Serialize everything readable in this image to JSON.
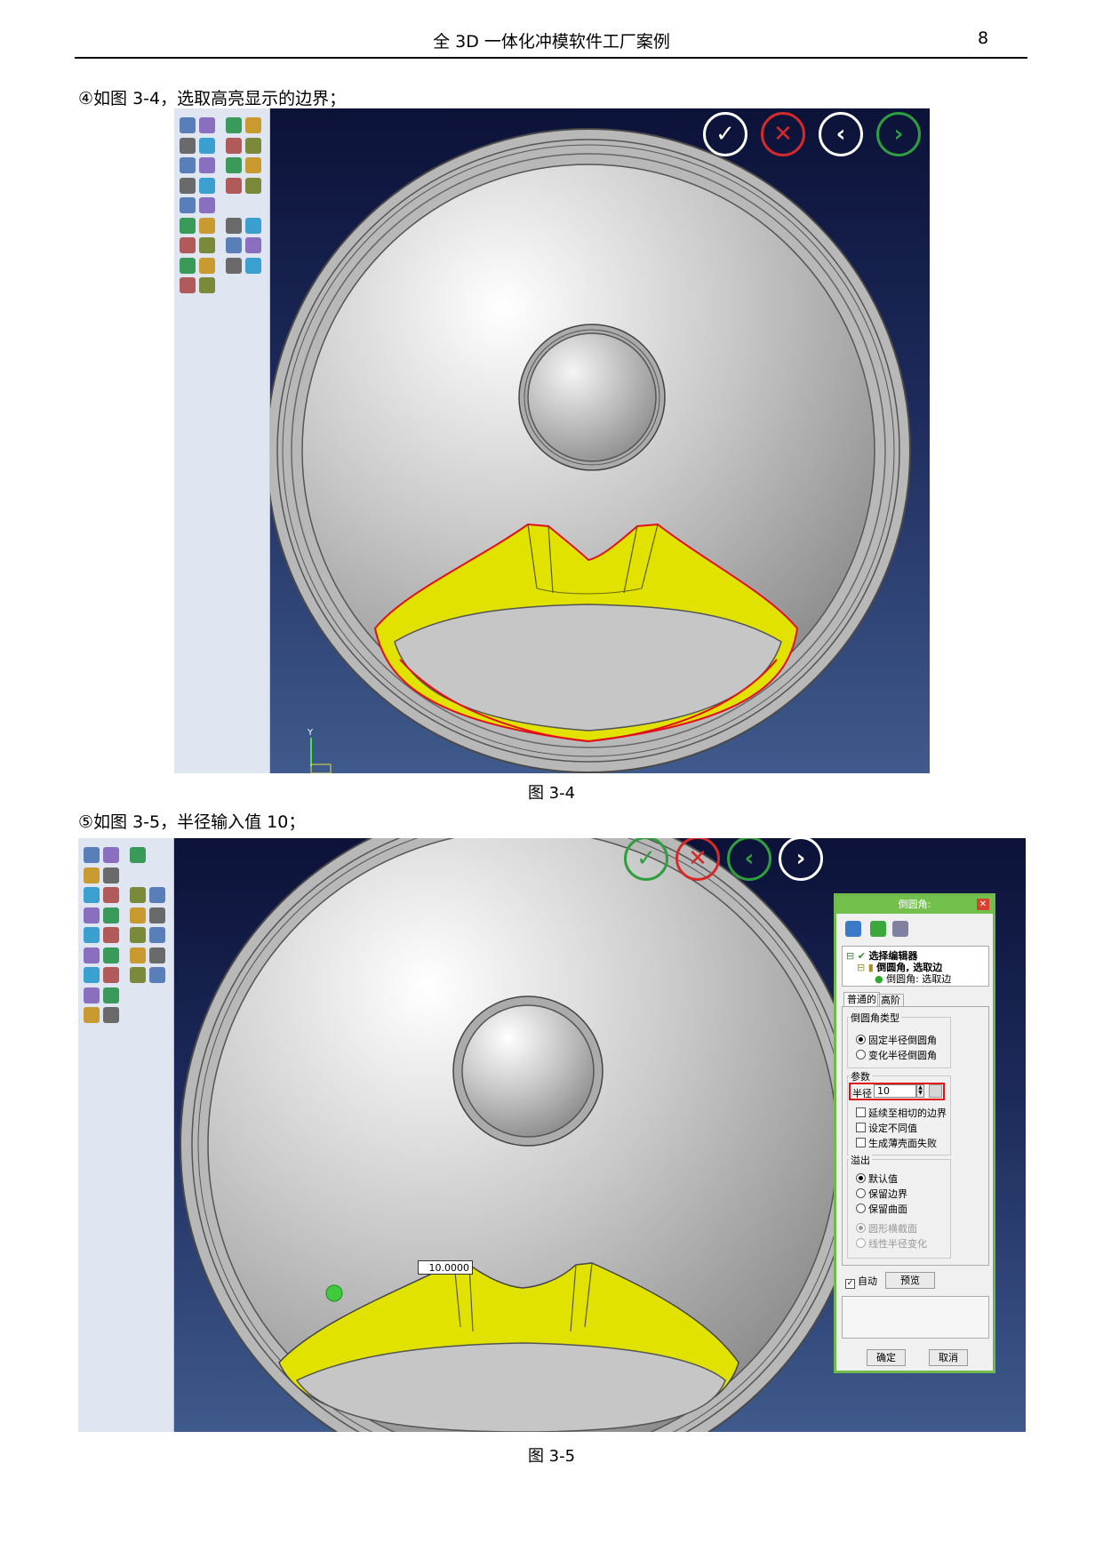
{
  "header": {
    "title": "全 3D 一体化冲模软件工厂案例",
    "page_number": "8"
  },
  "steps": [
    {
      "text": "④如图 3-4，选取高亮显示的边界；"
    },
    {
      "text": "⑤如图 3-5，半径输入值 10；"
    }
  ],
  "figures": [
    {
      "caption": "图 3-4"
    },
    {
      "caption": "图 3-5"
    }
  ],
  "confirm_buttons": {
    "ok": "✓",
    "cancel": "✕",
    "prev": "‹",
    "next": "›"
  },
  "axis_label": "Y",
  "fig2_value_tag": "10.0000",
  "dialog": {
    "title": "倒圆角:",
    "tree": {
      "root": "选择编辑器",
      "child": "倒圆角, 选取边",
      "leaf": "倒圆角: 选取边"
    },
    "tabs": {
      "normal": "普通的",
      "advanced": "高阶"
    },
    "type_group": {
      "label": "倒圆角类型",
      "options": [
        "固定半径倒圆角",
        "变化半径倒圆角"
      ]
    },
    "params_group": {
      "label": "参数",
      "radius_label": "半径",
      "radius_value": "10",
      "checks": [
        "延续至相切的边界",
        "设定不同值",
        "生成薄壳面失败"
      ]
    },
    "overflow_group": {
      "label": "溢出",
      "options": [
        "默认值",
        "保留边界",
        "保留曲面"
      ],
      "disabled_options": [
        "圆形横截面",
        "线性半径变化"
      ]
    },
    "auto_label": "自动",
    "preview_button": "预览",
    "ok_button": "确定",
    "cancel_button": "取消"
  },
  "colors": {
    "confirm_green": "#2e9e3e",
    "cancel_red": "#d52a2a",
    "highlight_yellow": "#e8e800",
    "edge_red": "#e0101a",
    "dialog_green": "#74c04d"
  }
}
